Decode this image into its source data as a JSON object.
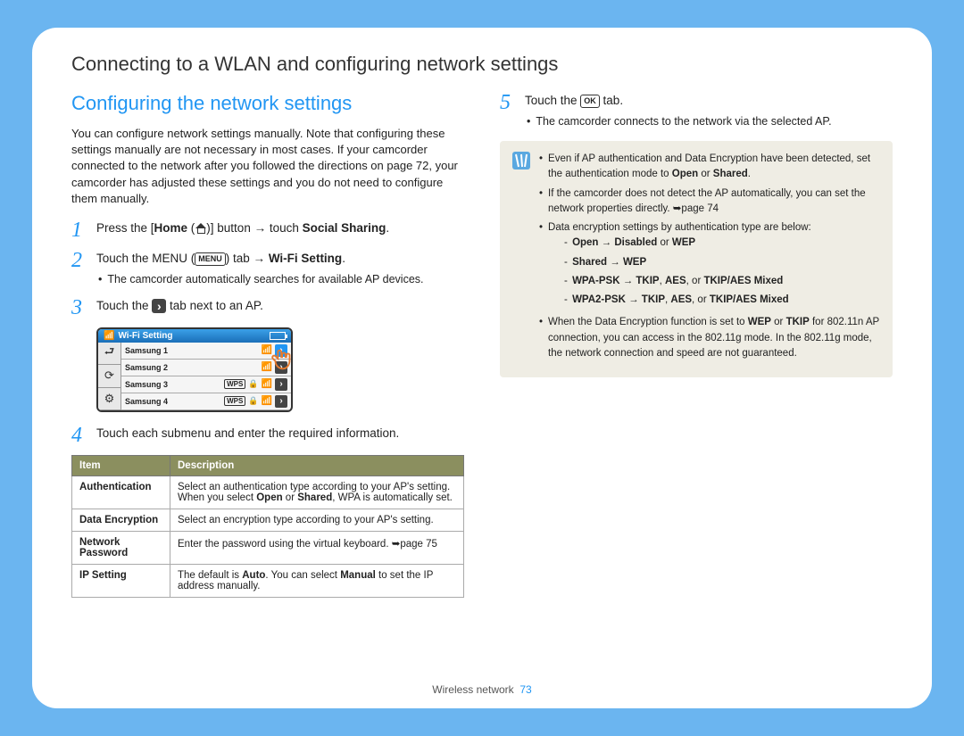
{
  "page_title": "Connecting to a WLAN and configuring network settings",
  "section_title": "Configuring the network settings",
  "intro": "You can configure network settings manually. Note that configuring these settings manually are not necessary in most cases. If your camcorder connected to the network after you followed the directions on page 72, your camcorder has adjusted these settings and you do not need to configure them manually.",
  "step1_a": "Press the [",
  "step1_home": "Home",
  "step1_b": " (",
  "step1_c": ")] button → touch ",
  "step1_d": "Social Sharing",
  "step1_e": ".",
  "step2_a": "Touch the MENU (",
  "step2_menu": "MENU",
  "step2_b": ") tab → ",
  "step2_c": "Wi-Fi Setting",
  "step2_d": ".",
  "step2_bullet": "The camcorder automatically searches for available AP devices.",
  "step3_a": "Touch the ",
  "step3_b": " tab next to an AP.",
  "wifi_title": "Wi-Fi Setting",
  "wifi_rows": [
    "Samsung 1",
    "Samsung 2",
    "Samsung 3",
    "Samsung 4"
  ],
  "wps_label": "WPS",
  "step4": "Touch each submenu and enter the required information.",
  "table": {
    "h1": "Item",
    "h2": "Description",
    "rows": [
      {
        "item": "Authentication",
        "desc_a": "Select an authentication type according to your AP's setting. When you select ",
        "b1": "Open",
        "mid": " or ",
        "b2": "Shared",
        "desc_b": ", WPA is automatically set."
      },
      {
        "item": "Data Encryption",
        "desc": "Select an encryption type according to your AP's setting."
      },
      {
        "item": "Network Password",
        "desc": "Enter the password using the virtual keyboard. ➥page 75"
      },
      {
        "item": "IP Setting",
        "desc_a": "The default is ",
        "b1": "Auto",
        "mid": ". You can select ",
        "b2": "Manual",
        "desc_b": " to set the IP address manually."
      }
    ]
  },
  "step5_a": "Touch the ",
  "step5_ok": "OK",
  "step5_b": " tab.",
  "step5_bullet": "The camcorder connects to the network via the selected AP.",
  "note": {
    "l1_a": "Even if AP authentication and Data Encryption have been detected, set the authentication mode to ",
    "l1_b1": "Open",
    "l1_mid": " or ",
    "l1_b2": "Shared",
    "l1_end": ".",
    "l2": "If the camcorder does not detect the AP automatically, you can set the network properties directly. ➥page 74",
    "l3": "Data encryption settings by authentication type are below:",
    "s1": "Open → Disabled",
    "s1b": " or ",
    "s1c": "WEP",
    "s2": "Shared → WEP",
    "s3": "WPA-PSK → TKIP",
    "s3b": ", ",
    "s3c": "AES",
    "s3d": ", or ",
    "s3e": "TKIP/AES Mixed",
    "s4": "WPA2-PSK → TKIP",
    "s4b": ", ",
    "s4c": "AES",
    "s4d": ", or ",
    "s4e": "TKIP/AES Mixed",
    "l4_a": "When the Data Encryption function is set to ",
    "l4_b1": "WEP",
    "l4_mid": " or ",
    "l4_b2": "TKIP",
    "l4_b": " for 802.11n AP connection, you can access in the 802.11g mode. In the 802.11g mode, the network connection and speed are not guaranteed."
  },
  "footer_label": "Wireless network",
  "footer_page": "73"
}
